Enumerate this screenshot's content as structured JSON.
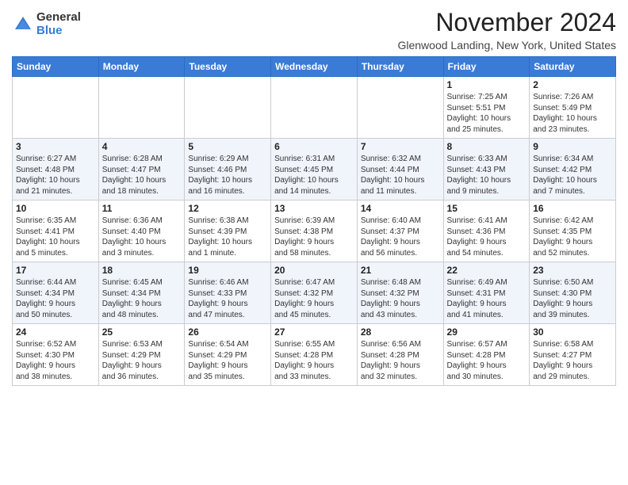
{
  "logo": {
    "general": "General",
    "blue": "Blue"
  },
  "header": {
    "month_title": "November 2024",
    "location": "Glenwood Landing, New York, United States"
  },
  "weekdays": [
    "Sunday",
    "Monday",
    "Tuesday",
    "Wednesday",
    "Thursday",
    "Friday",
    "Saturday"
  ],
  "weeks": [
    [
      {
        "day": "",
        "info": ""
      },
      {
        "day": "",
        "info": ""
      },
      {
        "day": "",
        "info": ""
      },
      {
        "day": "",
        "info": ""
      },
      {
        "day": "",
        "info": ""
      },
      {
        "day": "1",
        "info": "Sunrise: 7:25 AM\nSunset: 5:51 PM\nDaylight: 10 hours\nand 25 minutes."
      },
      {
        "day": "2",
        "info": "Sunrise: 7:26 AM\nSunset: 5:49 PM\nDaylight: 10 hours\nand 23 minutes."
      }
    ],
    [
      {
        "day": "3",
        "info": "Sunrise: 6:27 AM\nSunset: 4:48 PM\nDaylight: 10 hours\nand 21 minutes."
      },
      {
        "day": "4",
        "info": "Sunrise: 6:28 AM\nSunset: 4:47 PM\nDaylight: 10 hours\nand 18 minutes."
      },
      {
        "day": "5",
        "info": "Sunrise: 6:29 AM\nSunset: 4:46 PM\nDaylight: 10 hours\nand 16 minutes."
      },
      {
        "day": "6",
        "info": "Sunrise: 6:31 AM\nSunset: 4:45 PM\nDaylight: 10 hours\nand 14 minutes."
      },
      {
        "day": "7",
        "info": "Sunrise: 6:32 AM\nSunset: 4:44 PM\nDaylight: 10 hours\nand 11 minutes."
      },
      {
        "day": "8",
        "info": "Sunrise: 6:33 AM\nSunset: 4:43 PM\nDaylight: 10 hours\nand 9 minutes."
      },
      {
        "day": "9",
        "info": "Sunrise: 6:34 AM\nSunset: 4:42 PM\nDaylight: 10 hours\nand 7 minutes."
      }
    ],
    [
      {
        "day": "10",
        "info": "Sunrise: 6:35 AM\nSunset: 4:41 PM\nDaylight: 10 hours\nand 5 minutes."
      },
      {
        "day": "11",
        "info": "Sunrise: 6:36 AM\nSunset: 4:40 PM\nDaylight: 10 hours\nand 3 minutes."
      },
      {
        "day": "12",
        "info": "Sunrise: 6:38 AM\nSunset: 4:39 PM\nDaylight: 10 hours\nand 1 minute."
      },
      {
        "day": "13",
        "info": "Sunrise: 6:39 AM\nSunset: 4:38 PM\nDaylight: 9 hours\nand 58 minutes."
      },
      {
        "day": "14",
        "info": "Sunrise: 6:40 AM\nSunset: 4:37 PM\nDaylight: 9 hours\nand 56 minutes."
      },
      {
        "day": "15",
        "info": "Sunrise: 6:41 AM\nSunset: 4:36 PM\nDaylight: 9 hours\nand 54 minutes."
      },
      {
        "day": "16",
        "info": "Sunrise: 6:42 AM\nSunset: 4:35 PM\nDaylight: 9 hours\nand 52 minutes."
      }
    ],
    [
      {
        "day": "17",
        "info": "Sunrise: 6:44 AM\nSunset: 4:34 PM\nDaylight: 9 hours\nand 50 minutes."
      },
      {
        "day": "18",
        "info": "Sunrise: 6:45 AM\nSunset: 4:34 PM\nDaylight: 9 hours\nand 48 minutes."
      },
      {
        "day": "19",
        "info": "Sunrise: 6:46 AM\nSunset: 4:33 PM\nDaylight: 9 hours\nand 47 minutes."
      },
      {
        "day": "20",
        "info": "Sunrise: 6:47 AM\nSunset: 4:32 PM\nDaylight: 9 hours\nand 45 minutes."
      },
      {
        "day": "21",
        "info": "Sunrise: 6:48 AM\nSunset: 4:32 PM\nDaylight: 9 hours\nand 43 minutes."
      },
      {
        "day": "22",
        "info": "Sunrise: 6:49 AM\nSunset: 4:31 PM\nDaylight: 9 hours\nand 41 minutes."
      },
      {
        "day": "23",
        "info": "Sunrise: 6:50 AM\nSunset: 4:30 PM\nDaylight: 9 hours\nand 39 minutes."
      }
    ],
    [
      {
        "day": "24",
        "info": "Sunrise: 6:52 AM\nSunset: 4:30 PM\nDaylight: 9 hours\nand 38 minutes."
      },
      {
        "day": "25",
        "info": "Sunrise: 6:53 AM\nSunset: 4:29 PM\nDaylight: 9 hours\nand 36 minutes."
      },
      {
        "day": "26",
        "info": "Sunrise: 6:54 AM\nSunset: 4:29 PM\nDaylight: 9 hours\nand 35 minutes."
      },
      {
        "day": "27",
        "info": "Sunrise: 6:55 AM\nSunset: 4:28 PM\nDaylight: 9 hours\nand 33 minutes."
      },
      {
        "day": "28",
        "info": "Sunrise: 6:56 AM\nSunset: 4:28 PM\nDaylight: 9 hours\nand 32 minutes."
      },
      {
        "day": "29",
        "info": "Sunrise: 6:57 AM\nSunset: 4:28 PM\nDaylight: 9 hours\nand 30 minutes."
      },
      {
        "day": "30",
        "info": "Sunrise: 6:58 AM\nSunset: 4:27 PM\nDaylight: 9 hours\nand 29 minutes."
      }
    ]
  ]
}
